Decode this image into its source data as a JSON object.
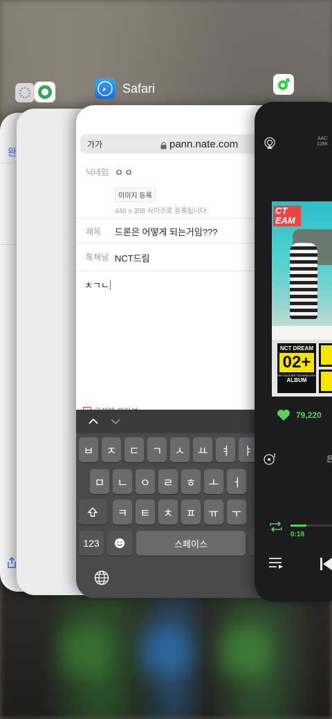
{
  "background_app_cards": {
    "card_a": {
      "done_label": "완"
    },
    "card_b_app_icon": "gear-icon"
  },
  "safari": {
    "app_name": "Safari",
    "url_bar": {
      "text_size_button": "가가",
      "url": "pann.nate.com"
    },
    "form": {
      "nickname": {
        "label": "닉네임",
        "value": "ㅇㅇ"
      },
      "image": {
        "button": "이미지 등록",
        "note": "440 x 358 사이즈로 등록됩니다."
      },
      "title": {
        "label": "제목",
        "value": "드론은 어떻게 되는거임???"
      },
      "channel": {
        "label": "톡채널",
        "value": "NCT드림"
      },
      "body_text": "ㅊㄱㄴ",
      "consent_partial": "규정에 의하여"
    },
    "keyboard": {
      "row1": [
        "ㅂ",
        "ㅈ",
        "ㄷ",
        "ㄱ",
        "ㅅ",
        "ㅛ",
        "ㅕ",
        "ㅑ"
      ],
      "row2": [
        "ㅁ",
        "ㄴ",
        "ㅇ",
        "ㄹ",
        "ㅎ",
        "ㅗ",
        "ㅓ"
      ],
      "row3": [
        "ㅋ",
        "ㅌ",
        "ㅊ",
        "ㅍ",
        "ㅠ",
        "ㅜ"
      ],
      "shift_icon": "shift-icon",
      "numbers_key": "123",
      "emoji_icon": "emoji-icon",
      "space_key": "스페이스",
      "globe_icon": "globe-icon"
    }
  },
  "music_app": {
    "aac_badge": [
      "AAC",
      "128K"
    ],
    "album": {
      "top_text": "CT EAM",
      "badge_artist": "NCT DREAM",
      "badge_number": "02+",
      "badge_label": "ALBUM",
      "badge_small": "SM CULTURE TECHNOLOGY"
    },
    "likes": "79,220",
    "elapsed_time": "0:18",
    "progress": 0.25,
    "partial_text": "은",
    "colors": {
      "accent": "#57d25c"
    }
  }
}
